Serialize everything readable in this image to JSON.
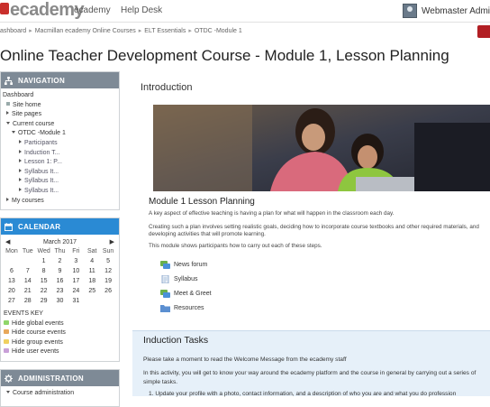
{
  "header": {
    "logo_text": "ecademy",
    "nav": [
      "ecademy",
      "Help Desk"
    ],
    "user_name": "Webmaster Admi"
  },
  "breadcrumb": [
    "ashboard",
    "Macmillan ecademy Online Courses",
    "ELT Essentials",
    "OTDC -Module 1"
  ],
  "page_title": "Online Teacher Development Course - Module 1, Lesson Planning",
  "navigation": {
    "title": "NAVIGATION",
    "items": [
      "Dashboard",
      "Site home",
      "Site pages",
      "Current course",
      "OTDC -Module 1",
      "Participants",
      "Induction T...",
      "Lesson 1: P...",
      "Syllabus It...",
      "Syllabus It...",
      "Syllabus It...",
      "My courses"
    ]
  },
  "calendar": {
    "title": "CALENDAR",
    "month": "March 2017",
    "days": [
      "Mon",
      "Tue",
      "Wed",
      "Thu",
      "Fri",
      "Sat",
      "Sun"
    ],
    "weeks": [
      [
        "",
        "",
        "1",
        "2",
        "3",
        "4",
        "5"
      ],
      [
        "6",
        "7",
        "8",
        "9",
        "10",
        "11",
        "12"
      ],
      [
        "13",
        "14",
        "15",
        "16",
        "17",
        "18",
        "19"
      ],
      [
        "20",
        "21",
        "22",
        "23",
        "24",
        "25",
        "26"
      ],
      [
        "27",
        "28",
        "29",
        "30",
        "31",
        "",
        ""
      ]
    ],
    "events_key_label": "EVENTS KEY",
    "events": [
      "Hide global events",
      "Hide course events",
      "Hide group events",
      "Hide user events"
    ],
    "event_colors": [
      "#8fd66a",
      "#e8a85a",
      "#f0d060",
      "#c9a0d8"
    ]
  },
  "administration": {
    "title": "ADMINISTRATION",
    "first_item": "Course administration"
  },
  "colors": {
    "nav_header": "#7e8a96",
    "calendar_header": "#2a8ad4",
    "admin_header": "#7e8a96",
    "red_button": "#b21f24"
  },
  "main": {
    "section_title": "Introduction",
    "module_title": "Module 1 Lesson Planning",
    "paragraphs": [
      "A key aspect of effective teaching is having a plan for what will happen in the classroom each day.",
      "Creating such a plan involves setting realistic goals, deciding how to incorporate course textbooks and other required materials, and",
      "developing activities that will promote learning.",
      "This module shows participants how to carry out each of these steps."
    ],
    "activities": [
      {
        "label": "News forum",
        "icon": "forum-icon"
      },
      {
        "label": "Syllabus",
        "icon": "page-icon"
      },
      {
        "label": "Meet & Greet",
        "icon": "forum-icon"
      },
      {
        "label": "Resources",
        "icon": "folder-icon"
      }
    ]
  },
  "induction": {
    "title": "Induction Tasks",
    "lines": [
      "Please take a moment to read the Welcome Message from the ecademy staff",
      "In this activity,  you will get to know your way around the ecademy platform and the course in general by carrying out a series of",
      "simple tasks.",
      "1. Update your profile with a photo, contact information, and a description of who you are and what you do profession"
    ]
  }
}
